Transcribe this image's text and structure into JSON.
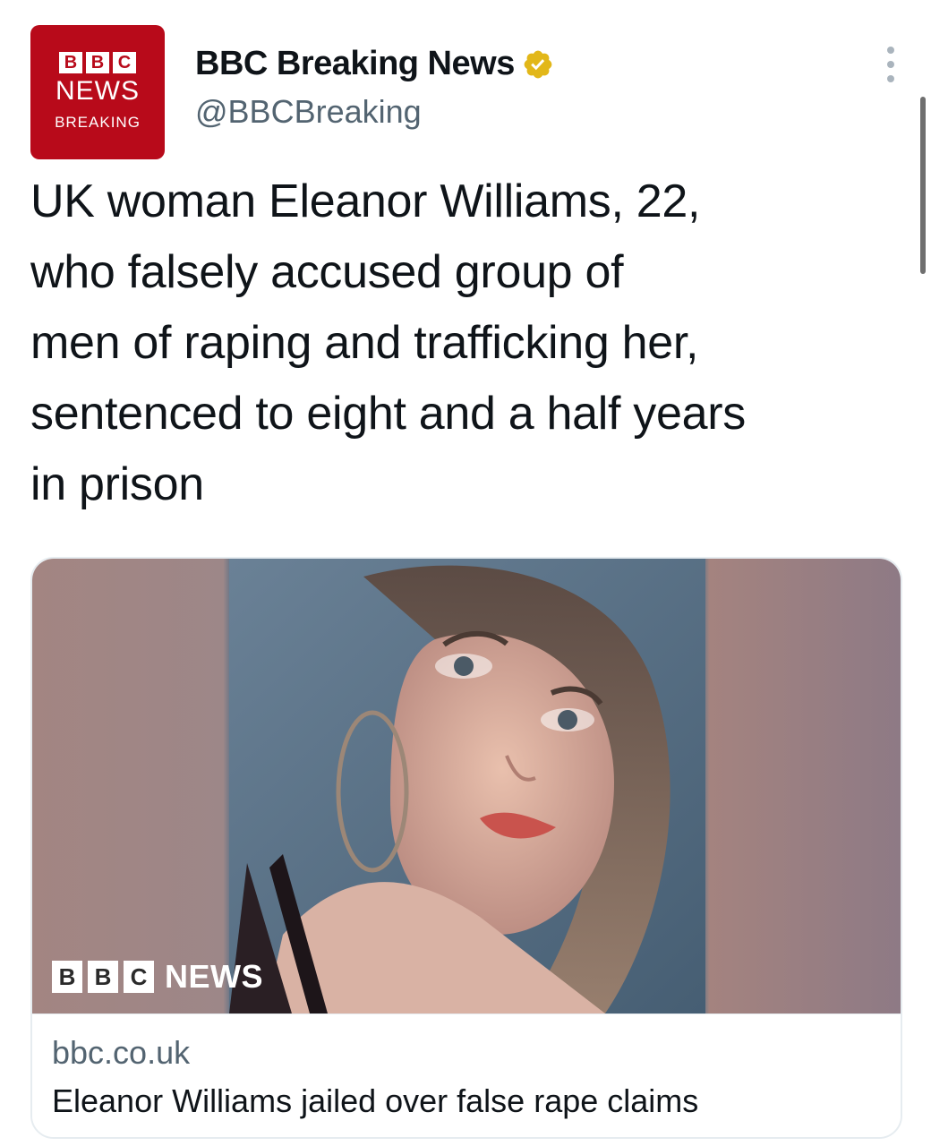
{
  "account": {
    "display_name": "BBC Breaking News",
    "handle": "@BBCBreaking",
    "verified": true,
    "avatar": {
      "blocks": [
        "B",
        "B",
        "C"
      ],
      "line1": "NEWS",
      "line2": "BREAKING",
      "background": "#b80a1a"
    }
  },
  "tweet": {
    "lines": [
      "UK woman Eleanor Williams, 22,",
      "who falsely accused group of",
      "men of raping and trafficking her,",
      "sentenced to eight and a half years",
      "in prison"
    ]
  },
  "card": {
    "image_logo": {
      "blocks": [
        "B",
        "B",
        "C"
      ],
      "text": "NEWS"
    },
    "domain": "bbc.co.uk",
    "title": "Eleanor Williams jailed over false rape claims"
  },
  "icons": {
    "verified": "verified-badge-icon",
    "more": "more-options-icon"
  },
  "colors": {
    "brand_red": "#b80a1a",
    "verified_gold": "#e2b719",
    "secondary_text": "#536471"
  }
}
